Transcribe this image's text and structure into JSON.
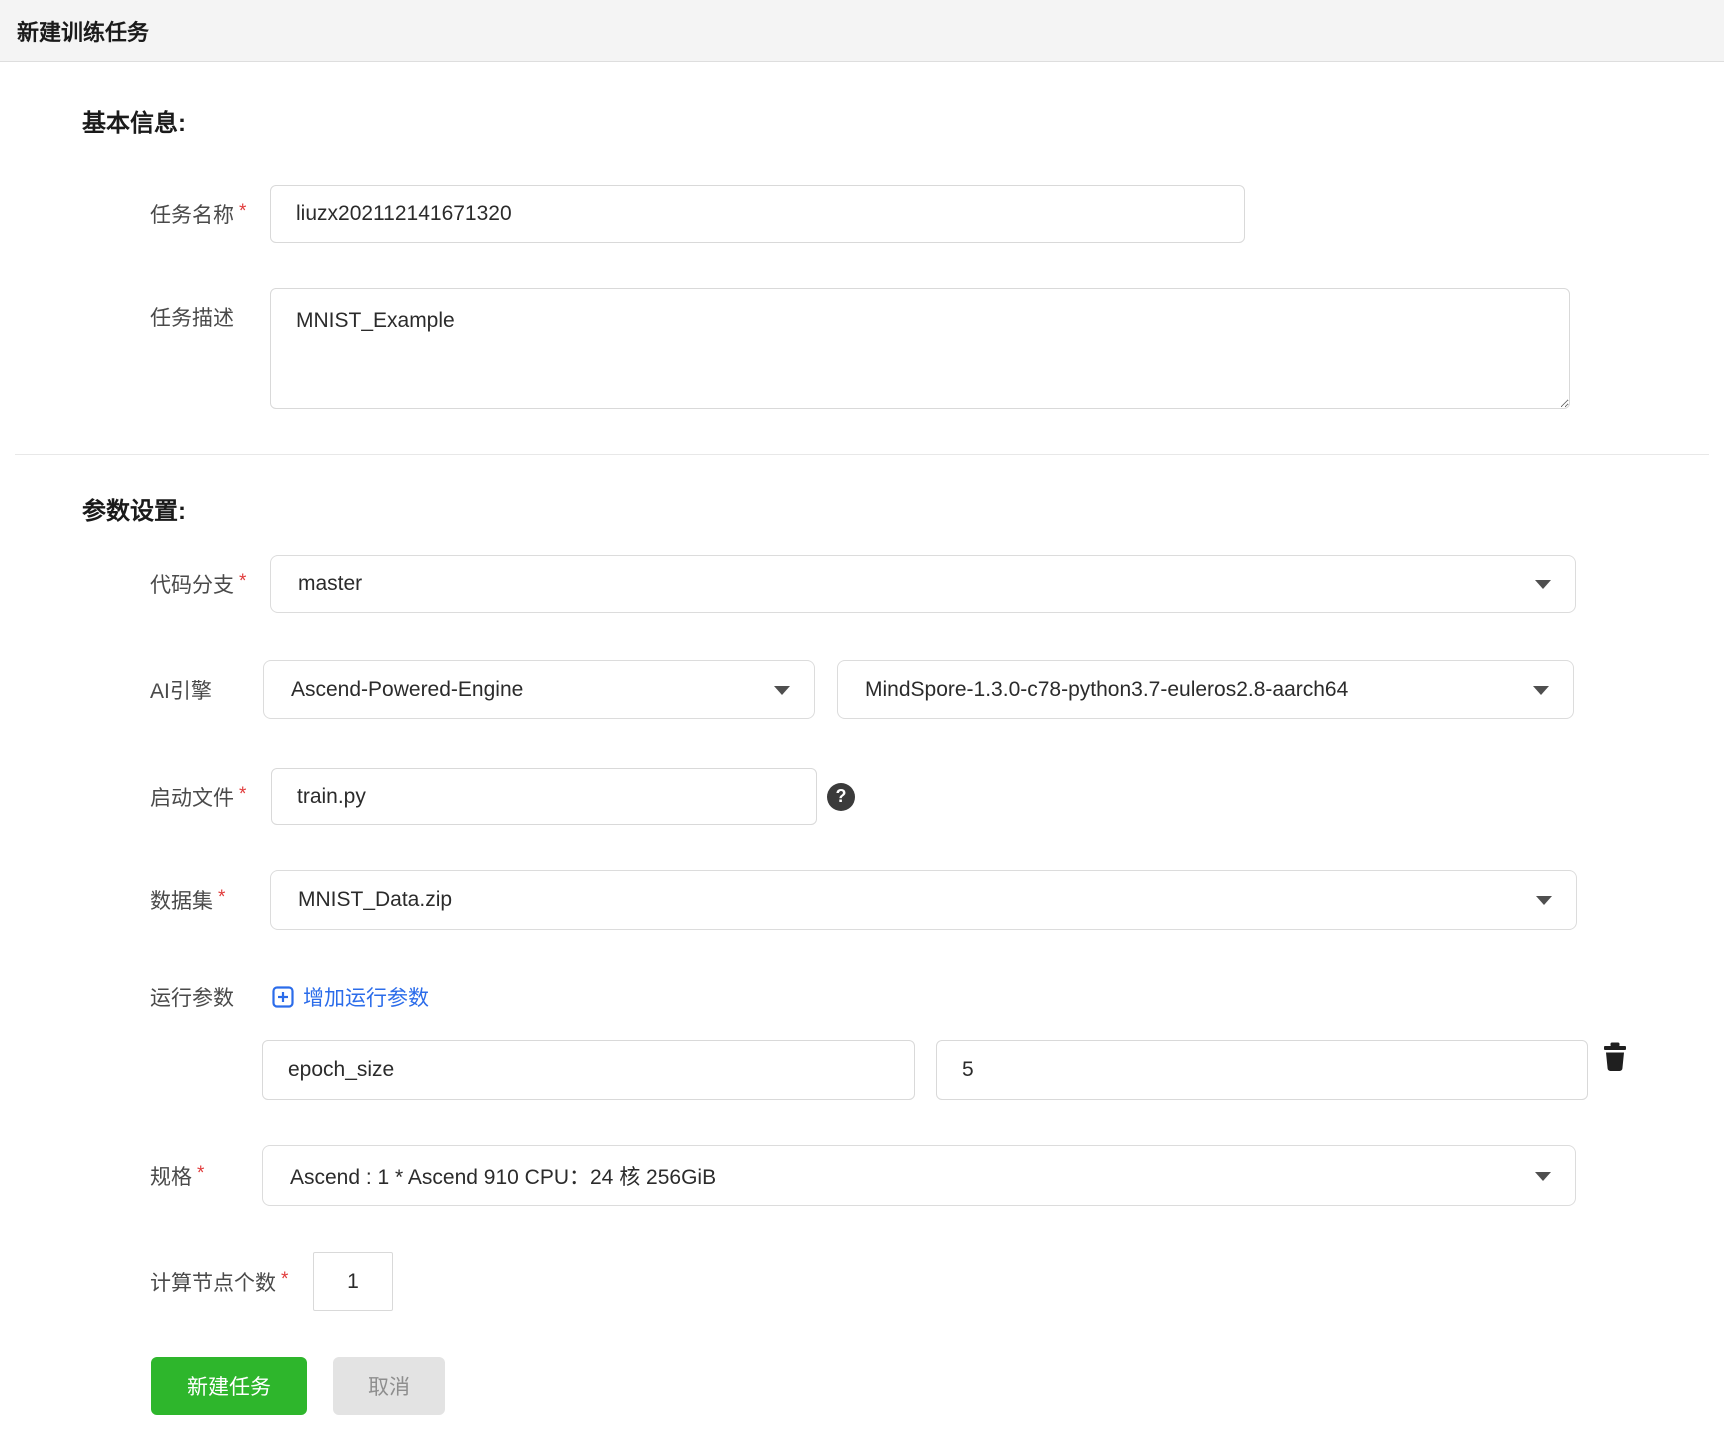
{
  "header": {
    "title": "新建训练任务"
  },
  "sections": {
    "basic_heading": "基本信息:",
    "params_heading": "参数设置:"
  },
  "misc": {
    "required_mark": "*",
    "help_glyph": "?"
  },
  "fields": {
    "task_name": {
      "label": "任务名称",
      "required": true,
      "value": "liuzx202112141671320"
    },
    "task_desc": {
      "label": "任务描述",
      "required": false,
      "value": "MNIST_Example"
    },
    "code_branch": {
      "label": "代码分支",
      "required": true,
      "value": "master"
    },
    "ai_engine": {
      "label": "AI引擎",
      "required": false,
      "engine_value": "Ascend-Powered-Engine",
      "version_value": "MindSpore-1.3.0-c78-python3.7-euleros2.8-aarch64"
    },
    "boot_file": {
      "label": "启动文件",
      "required": true,
      "value": "train.py"
    },
    "dataset": {
      "label": "数据集",
      "required": true,
      "value": "MNIST_Data.zip"
    },
    "run_params": {
      "label": "运行参数",
      "add_label": "增加运行参数",
      "entries": [
        {
          "key": "epoch_size",
          "value": "5"
        }
      ]
    },
    "spec": {
      "label": "规格",
      "required": true,
      "value": "Ascend : 1 * Ascend 910 CPU：24 核 256GiB"
    },
    "node_count": {
      "label": "计算节点个数",
      "required": true,
      "value": "1"
    }
  },
  "buttons": {
    "create": "新建任务",
    "cancel": "取消"
  },
  "icons": {
    "add": "plus-square-icon",
    "help": "question-circle-icon",
    "delete": "trash-icon",
    "dropdown": "caret-down-icon"
  },
  "colors": {
    "link_blue": "#2b6cea",
    "primary_green": "#2eb62c",
    "required_red": "#e13b3b",
    "titlebar_bg": "#f4f4f4",
    "input_border": "#d9d9d9"
  }
}
